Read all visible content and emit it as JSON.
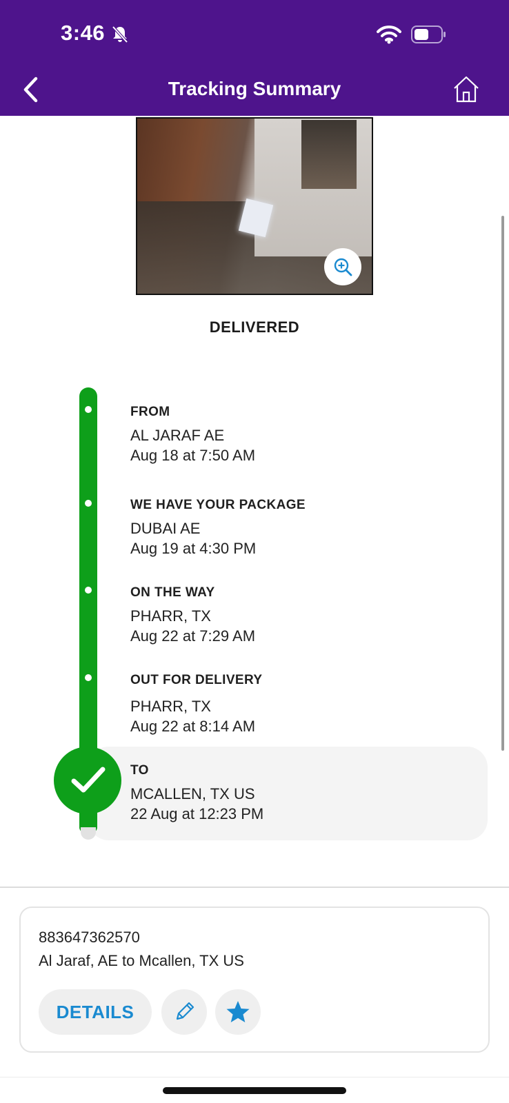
{
  "status_bar": {
    "time": "3:46"
  },
  "header": {
    "title": "Tracking Summary"
  },
  "shipment": {
    "status": "DELIVERED",
    "events": [
      {
        "label": "FROM",
        "location": "AL JARAF AE",
        "datetime": "Aug 18 at 7:50 AM"
      },
      {
        "label": "WE HAVE YOUR PACKAGE",
        "location": "DUBAI AE",
        "datetime": "Aug 19 at 4:30 PM"
      },
      {
        "label": "ON THE WAY",
        "location": "PHARR, TX",
        "datetime": "Aug 22 at 7:29 AM"
      },
      {
        "label": "OUT FOR DELIVERY",
        "location": "PHARR, TX",
        "datetime": "Aug 22 at 8:14 AM"
      },
      {
        "label": "TO",
        "location": "MCALLEN, TX US",
        "datetime": "22 Aug at 12:23 PM"
      }
    ]
  },
  "card": {
    "tracking_number": "883647362570",
    "route": "Al Jaraf, AE to Mcallen, TX US",
    "details_label": "DETAILS"
  },
  "colors": {
    "header_bg": "#4e148c",
    "timeline_green": "#0e9f1a",
    "link_blue": "#1a8ad0"
  },
  "icons": [
    "bell-slash-icon",
    "wifi-icon",
    "battery-icon",
    "back-chevron-icon",
    "home-icon",
    "zoom-in-icon",
    "checkmark-icon",
    "pencil-icon",
    "star-icon"
  ]
}
